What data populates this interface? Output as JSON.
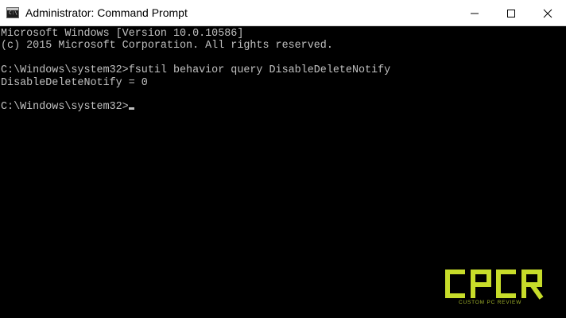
{
  "window": {
    "title": "Administrator: Command Prompt",
    "icon": "console-icon",
    "buttons": {
      "minimize": "minimize-icon",
      "maximize": "maximize-icon",
      "close": "close-icon"
    }
  },
  "console": {
    "lines": [
      "Microsoft Windows [Version 10.0.10586]",
      "(c) 2015 Microsoft Corporation. All rights reserved.",
      "",
      "C:\\Windows\\system32>fsutil behavior query DisableDeleteNotify",
      "DisableDeleteNotify = 0",
      "",
      "C:\\Windows\\system32>"
    ],
    "text_color": "#c0c0c0",
    "background": "#000000"
  },
  "watermark": {
    "logo_text": "CPCR",
    "tagline": "CUSTOM PC REVIEW",
    "color": "#c7dc2a"
  }
}
